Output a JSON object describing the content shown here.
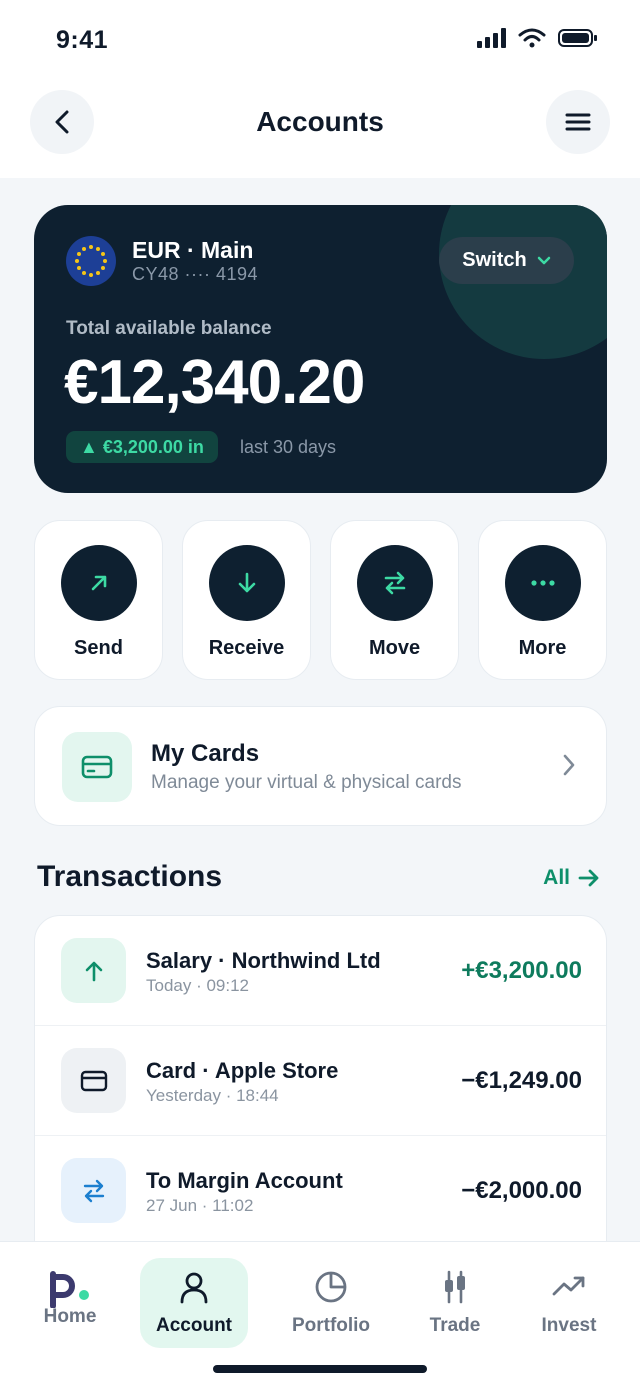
{
  "status": {
    "time": "9:41"
  },
  "header": {
    "title": "Accounts"
  },
  "balance": {
    "account_name": "EUR · Main",
    "iban": "CY48 ···· 4194",
    "switch_label": "Switch",
    "label": "Total available balance",
    "amount": "€12,340.20",
    "inflow": "▲ €3,200.00 in",
    "period": "last 30 days"
  },
  "actions": [
    {
      "label": "Send",
      "icon": "arrow-up-right-icon"
    },
    {
      "label": "Receive",
      "icon": "arrow-down-icon"
    },
    {
      "label": "Move",
      "icon": "swap-icon"
    },
    {
      "label": "More",
      "icon": "more-dots-icon"
    }
  ],
  "cards": {
    "title": "My Cards",
    "subtitle": "Manage your virtual & physical cards"
  },
  "transactions": {
    "heading": "Transactions",
    "all_label": "All",
    "items": [
      {
        "title": "Salary · Northwind Ltd",
        "time": "Today · 09:12",
        "amount": "+€3,200.00"
      },
      {
        "title": "Card · Apple Store",
        "time": "Yesterday · 18:44",
        "amount": "−€1,249.00"
      },
      {
        "title": "To Margin Account",
        "time": "27 Jun · 11:02",
        "amount": "−€2,000.00"
      }
    ]
  },
  "tabs": [
    {
      "label": "Home"
    },
    {
      "label": "Account"
    },
    {
      "label": "Portfolio"
    },
    {
      "label": "Trade"
    },
    {
      "label": "Invest"
    }
  ],
  "colors": {
    "accent": "#0e8f6a",
    "card_dark": "#0e2030",
    "positive": "#3ddaa4"
  }
}
